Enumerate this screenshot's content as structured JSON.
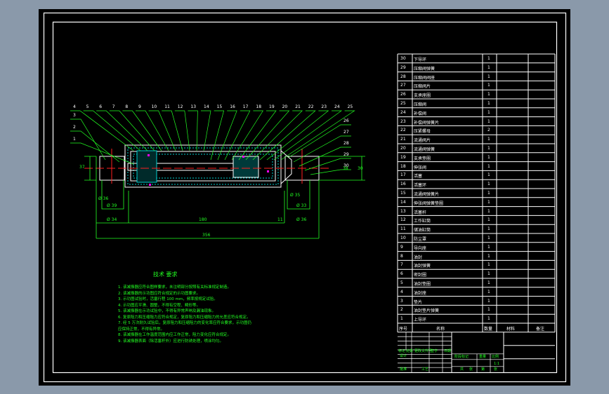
{
  "colors": {
    "background": "#8a99aa",
    "sheet": "#000000",
    "lines": "#ffffff",
    "annotation": "#22ff22",
    "centerline": "#ff2020",
    "hatch": "#00cccc",
    "highlight": "#ff00ff"
  },
  "drawing": {
    "balloons_top": [
      "4",
      "5",
      "6",
      "7",
      "8",
      "9",
      "10",
      "11",
      "12",
      "13",
      "14",
      "15",
      "16",
      "17",
      "18",
      "19",
      "20",
      "21",
      "22",
      "23",
      "24",
      "25"
    ],
    "balloons_left": [
      "3",
      "2",
      "1"
    ],
    "balloons_right": [
      "26",
      "27",
      "28",
      "29",
      "30"
    ],
    "dimensions": {
      "d_left_small": "Ø 36",
      "d_left_mid": "Ø 39",
      "d_left_large": "Ø 34",
      "len_180": "180",
      "len_total": "356",
      "d_right_small": "Ø 35",
      "d_right_mid": "Ø 33",
      "d_right_large": "Ø 36",
      "gap": "11",
      "h_left": "37",
      "h_right": "38",
      "h_right2": "30"
    }
  },
  "tech_requirements": {
    "title": "技术 要求",
    "items": [
      "1. 该减振器应符合图样要求，未注明部分按照有关标准规定制造。",
      "2. 该减振器的示功图应符合规定的示功图要求。",
      "3. 示功图试验时，活塞行程 100 mm，频率按规定试验。",
      "4. 示功图应平滑、圆整，不得有空程、畸形等。",
      "5. 该减振器在示功试验中，不得有异常声响及漏油现象。",
      "6. 复原阻力和压缩阻力应符合规定，复原阻力和压缩阻力的允差应符合规定。",
      "7. 经 5 万次耐久试验后，复原阻力和压缩阻力的变化率应符合要求，示功图仍",
      "   应保持正常，不得有异常。",
      "8. 该减振器在工作温度范围内应工作正常，阻力变化应符合规定。",
      "9. 该减振器表面（除活塞杆外）应进行防锈处理，喷涂均匀。"
    ]
  },
  "parts_list": {
    "rows": [
      {
        "no": "30",
        "name": "下导环",
        "qty": "1"
      },
      {
        "no": "29",
        "name": "压缩阀弹簧",
        "qty": "1"
      },
      {
        "no": "28",
        "name": "压缩阀阀座",
        "qty": "1"
      },
      {
        "no": "27",
        "name": "压缩阀片",
        "qty": "1"
      },
      {
        "no": "26",
        "name": "支承座圈",
        "qty": "1"
      },
      {
        "no": "25",
        "name": "压缩阀",
        "qty": "1"
      },
      {
        "no": "24",
        "name": "补偿阀",
        "qty": "1"
      },
      {
        "no": "23",
        "name": "补偿阀弹簧片",
        "qty": "1"
      },
      {
        "no": "22",
        "name": "压紧螺母",
        "qty": "2"
      },
      {
        "no": "21",
        "name": "流通阀片",
        "qty": "1"
      },
      {
        "no": "20",
        "name": "流通阀弹簧",
        "qty": "1"
      },
      {
        "no": "19",
        "name": "支承垫圈",
        "qty": "1"
      },
      {
        "no": "18",
        "name": "伸张阀",
        "qty": "1"
      },
      {
        "no": "17",
        "name": "活塞",
        "qty": "1"
      },
      {
        "no": "16",
        "name": "活塞环",
        "qty": "1"
      },
      {
        "no": "15",
        "name": "流通阀弹簧片",
        "qty": "1"
      },
      {
        "no": "14",
        "name": "伸张阀弹簧垫圈",
        "qty": "1"
      },
      {
        "no": "13",
        "name": "活塞杆",
        "qty": "1"
      },
      {
        "no": "12",
        "name": "工作缸筒",
        "qty": "1"
      },
      {
        "no": "11",
        "name": "储油缸筒",
        "qty": "1"
      },
      {
        "no": "10",
        "name": "防尘罩",
        "qty": "1"
      },
      {
        "no": "9",
        "name": "导向座",
        "qty": "1"
      },
      {
        "no": "8",
        "name": "油封",
        "qty": "1"
      },
      {
        "no": "7",
        "name": "油封弹簧",
        "qty": "1"
      },
      {
        "no": "6",
        "name": "密封圈",
        "qty": "1"
      },
      {
        "no": "5",
        "name": "油封垫圈",
        "qty": "1"
      },
      {
        "no": "4",
        "name": "油封座",
        "qty": "1"
      },
      {
        "no": "3",
        "name": "垫片",
        "qty": "1"
      },
      {
        "no": "2",
        "name": "油封垫片弹簧",
        "qty": "1"
      },
      {
        "no": "1",
        "name": "上导环",
        "qty": "1"
      }
    ],
    "header": {
      "no": "序号",
      "name": "名称",
      "qty": "数量",
      "material": "材料",
      "remark": "备注"
    }
  },
  "title_block": {
    "mark": "标记",
    "count": "处数",
    "file": "更改文件号",
    "sign": "签字",
    "date": "日期",
    "design": "设计",
    "process": "工艺",
    "stage_mark": "阶段标记",
    "weight": "重量",
    "scale": "比例",
    "scale_val": "1:1",
    "sheet": "共",
    "sheet2": "张",
    "sheet3": "第",
    "sheet4": "张",
    "approve": "批准"
  }
}
